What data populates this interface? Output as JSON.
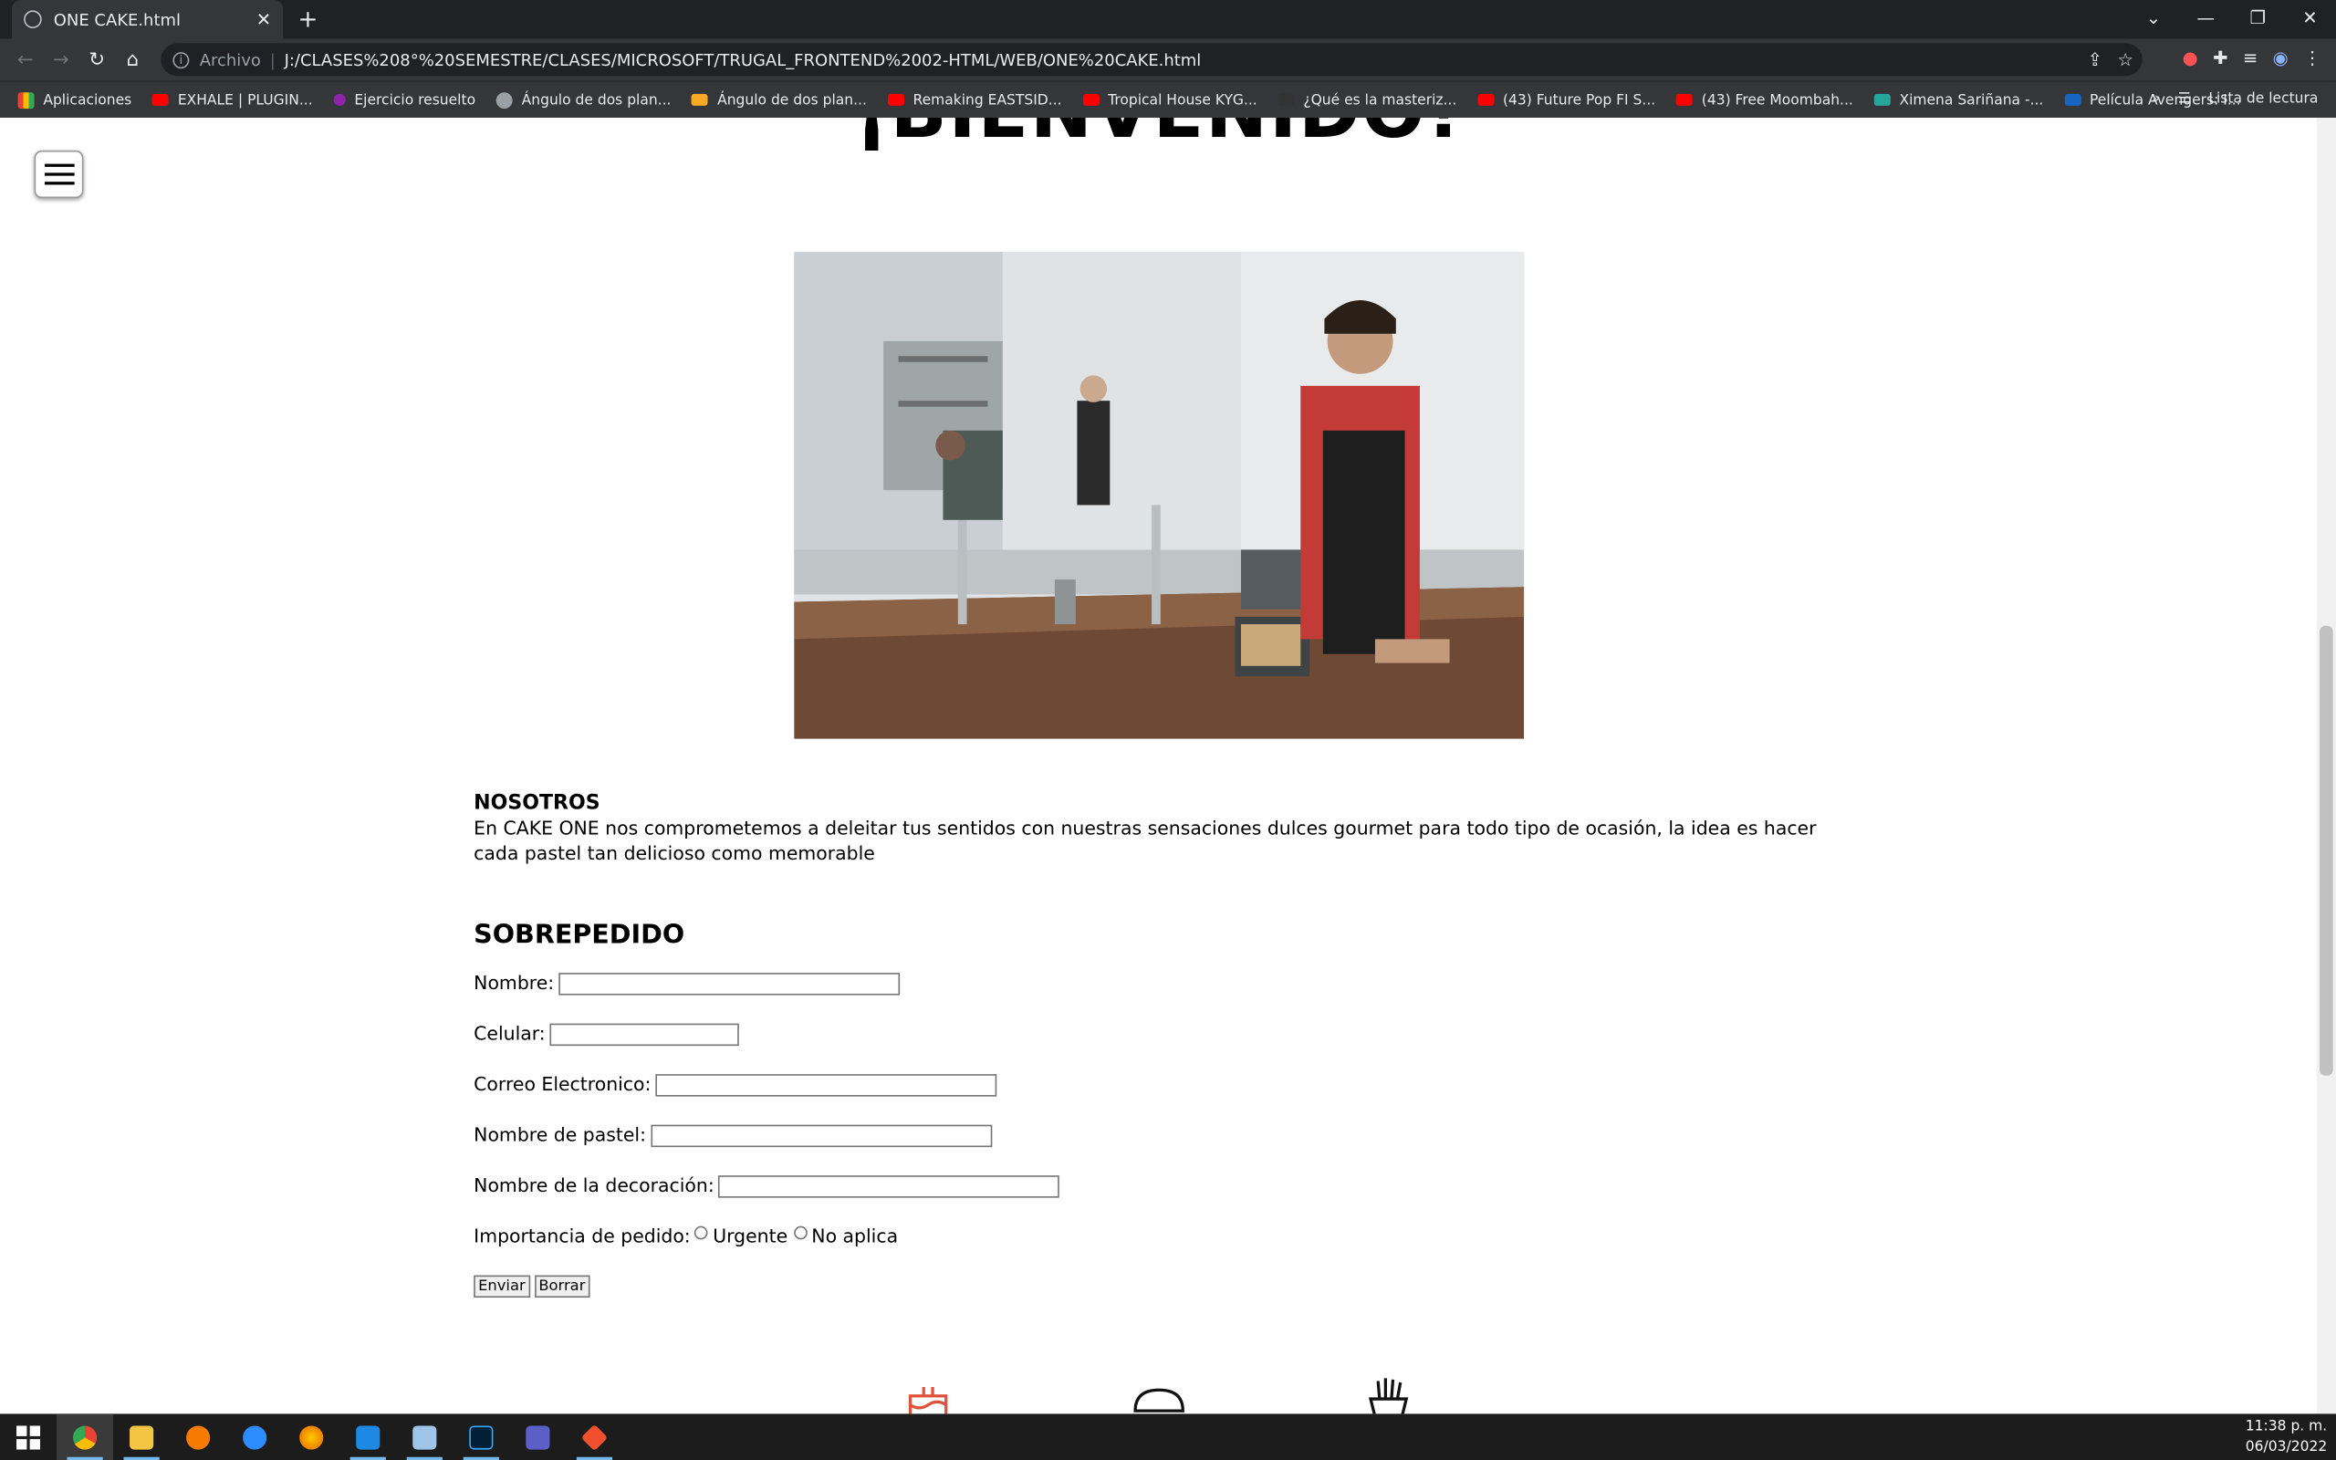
{
  "browser": {
    "tab_title": "ONE CAKE.html",
    "new_tab": "+",
    "address_prefix": "Archivo",
    "address_sep": "|",
    "url": "J:/CLASES%208°%20SEMESTRE/CLASES/MICROSOFT/TRUGAL_FRONTEND%2002-HTML/WEB/ONE%20CAKE.html",
    "bookmarks": [
      {
        "label": "Aplicaciones",
        "icon": "grid"
      },
      {
        "label": "EXHALE | PLUGIN...",
        "icon": "yt"
      },
      {
        "label": "Ejercicio resuelto",
        "icon": "pu"
      },
      {
        "label": "Ángulo de dos plan...",
        "icon": "gr"
      },
      {
        "label": "Ángulo de dos plan...",
        "icon": "or"
      },
      {
        "label": "Remaking EASTSID...",
        "icon": "yt"
      },
      {
        "label": "Tropical House KYG...",
        "icon": "yt"
      },
      {
        "label": "¿Qué es la masteriz...",
        "icon": "dk"
      },
      {
        "label": "(43) Future Pop FI S...",
        "icon": "yt"
      },
      {
        "label": "(43) Free Moombah...",
        "icon": "yt"
      },
      {
        "label": "Ximena Sariñana -...",
        "icon": "tl"
      },
      {
        "label": "Película Avengers: I...",
        "icon": "bl"
      }
    ],
    "more_bookmarks": "»",
    "reading_list": "Lista de lectura"
  },
  "page": {
    "heading": "¡BIENVENIDO!",
    "about_title": "NOSOTROS",
    "about_text": "En CAKE ONE nos comprometemos a deleitar tus sentidos con nuestras sensaciones dulces gourmet para todo tipo de ocasión, la idea es hacer cada pastel tan delicioso como memorable",
    "form_title": "SOBREPEDIDO",
    "fields": {
      "name": "Nombre:",
      "phone": "Celular:",
      "email": "Correo Electronico:",
      "cake": "Nombre de pastel:",
      "decoration": "Nombre de la decoración:"
    },
    "priority_label": "Importancia de pedido:",
    "priority_options": [
      "Urgente",
      "No aplica"
    ],
    "submit": "Enviar",
    "reset": "Borrar"
  },
  "taskbar": {
    "time": "11:38 p. m.",
    "date": "06/03/2022",
    "apps": [
      "chrome",
      "explorer",
      "fl-studio",
      "zoom",
      "firefox",
      "vscode",
      "notepad",
      "photoshop",
      "teams",
      "git"
    ]
  }
}
